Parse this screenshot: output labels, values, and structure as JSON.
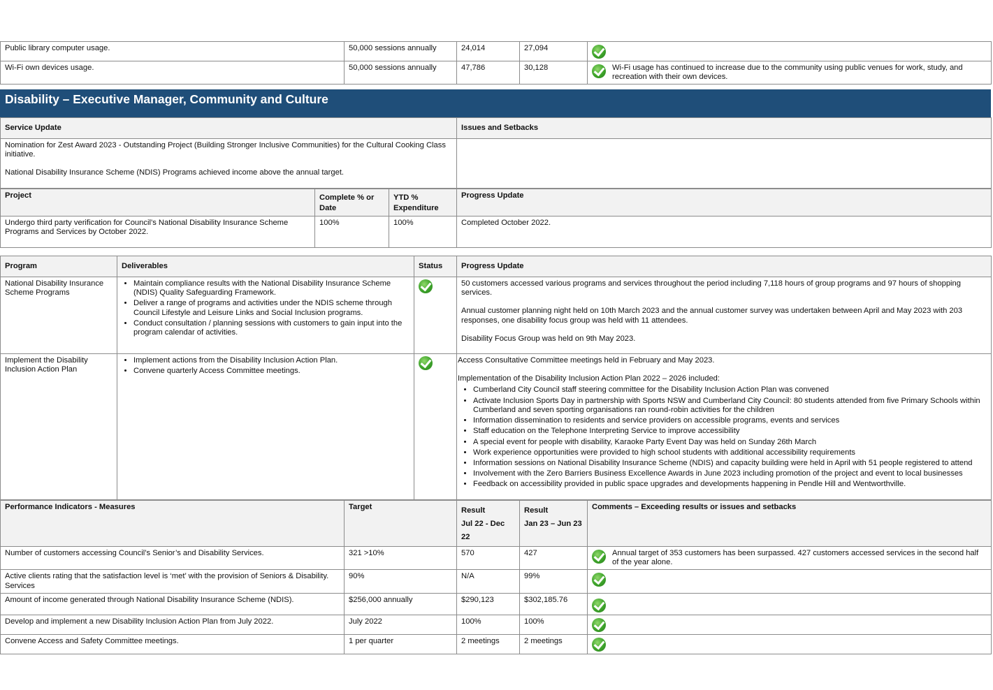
{
  "top_rows": [
    {
      "measure": "Public library computer usage.",
      "target": "50,000 sessions annually",
      "r1": "24,014",
      "r2": "27,094",
      "status_icon": "check-icon",
      "comment": ""
    },
    {
      "measure": "Wi-Fi own devices usage.",
      "target": "50,000 sessions annually",
      "r1": "47,786",
      "r2": "30,128",
      "status_icon": "check-icon",
      "comment": "Wi-Fi usage has continued to increase due to the community using public venues for work, study, and recreation with their own devices."
    }
  ],
  "section": {
    "title": "Disability – Executive Manager, Community and Culture",
    "service_update_header": "Service Update",
    "issues_header": "Issues and Setbacks",
    "service_update_p1": "Nomination for Zest Award 2023 - Outstanding Project (Building Stronger Inclusive Communities) for the Cultural Cooking Class initiative.",
    "service_update_p2": "National Disability Insurance Scheme (NDIS) Programs achieved income above the annual target.",
    "issues_text": ""
  },
  "project": {
    "headers": {
      "project": "Project",
      "complete": "Complete % or Date",
      "ytd": "YTD % Expenditure",
      "progress": "Progress Update"
    },
    "row": {
      "project": "Undergo third party verification for Council’s National Disability Insurance Scheme Programs  and Services by October 2022.",
      "complete": "100%",
      "ytd": "100%",
      "progress": "Completed October 2022."
    }
  },
  "programs": {
    "headers": {
      "program": "Program",
      "deliverables": "Deliverables",
      "status": "Status",
      "progress": "Progress Update"
    },
    "rows": [
      {
        "program": "National Disability Insurance Scheme Programs",
        "deliverables": [
          "Maintain compliance results with the National Disability Insurance Scheme (NDIS)  Quality Safeguarding Framework.",
          "Deliver a range of programs and activities under the NDIS scheme through Council    Lifestyle and Leisure Links and Social Inclusion programs.",
          "Conduct consultation / planning sessions with customers to gain input into the program calendar of activities."
        ],
        "status_icon": "check-icon",
        "progress_p": [
          "50 customers accessed various programs and services throughout the period including 7,118 hours of group programs and 97 hours of shopping services.",
          "Annual customer planning night held on 10th March 2023 and the annual customer survey was undertaken between April and May 2023 with 203 responses, one disability focus group was held with 11 attendees.",
          "Disability Focus Group was held on 9th May 2023."
        ]
      },
      {
        "program": "Implement the Disability Inclusion Action Plan",
        "deliverables": [
          "Implement actions from the Disability Inclusion Action Plan.",
          "Convene quarterly Access Committee meetings."
        ],
        "status_icon": "check-icon",
        "progress_p1": "Access Consultative Committee meetings held in February and May 2023.",
        "progress_p2": "Implementation of the Disability Inclusion Action Plan 2022 – 2026 included:",
        "progress_list": [
          "Cumberland City Council staff steering committee for the Disability Inclusion Action Plan was convened",
          "Activate Inclusion Sports Day in partnership with Sports NSW and Cumberland City Council: 80 students attended from five Primary Schools within Cumberland and seven sporting organisations ran round-robin activities for the children",
          "Information dissemination to residents and service providers on accessible programs, events and services",
          "Staff education on the Telephone Interpreting Service to improve accessibility",
          "A special event for people with disability, Karaoke Party Event Day was held on Sunday 26th March",
          "Work experience opportunities were provided to high school students with additional accessibility requirements",
          "Information sessions on National Disability Insurance Scheme (NDIS) and capacity building were held in April with 51 people registered to attend",
          "Involvement with the Zero Barriers Business Excellence Awards in June 2023 including promotion of the project and event to local businesses",
          "Feedback on accessibility provided in public space upgrades and developments happening in Pendle Hill and Wentworthville."
        ]
      }
    ]
  },
  "kpi": {
    "headers": {
      "measure": "Performance Indicators - Measures",
      "target": "Target",
      "result": "Result",
      "period1": "Jul 22 - Dec 22",
      "period2": "Jan 23 – Jun 23",
      "comments": "Comments – Exceeding results or issues and setbacks"
    },
    "rows": [
      {
        "measure": "Number of customers accessing Council’s Senior’s and Disability Services.",
        "target": "321 >10%",
        "r1": "570",
        "r2": "427",
        "status_icon": "check-icon",
        "comment": "Annual target of 353 customers has been surpassed. 427 customers accessed services in the second half of the year alone."
      },
      {
        "measure": "Active clients rating that the satisfaction level is ‘met’ with the provision of Seniors & Disability. Services",
        "target": "90%",
        "r1": "N/A",
        "r2": "99%",
        "status_icon": "check-icon",
        "comment": ""
      },
      {
        "measure": "Amount of income generated through National Disability Insurance Scheme (NDIS).",
        "target": "$256,000 annually",
        "r1": "$290,123",
        "r2": "$302,185.76",
        "status_icon": "check-icon",
        "comment": ""
      },
      {
        "measure": "Develop and implement a new Disability Inclusion Action Plan from July 2022.",
        "target": "July 2022",
        "r1": "100%",
        "r2": "100%",
        "status_icon": "check-icon",
        "comment": ""
      },
      {
        "measure": "Convene Access and Safety Committee meetings.",
        "target": "1 per quarter",
        "r1": "2 meetings",
        "r2": "2 meetings",
        "status_icon": "check-icon",
        "comment": ""
      }
    ]
  }
}
